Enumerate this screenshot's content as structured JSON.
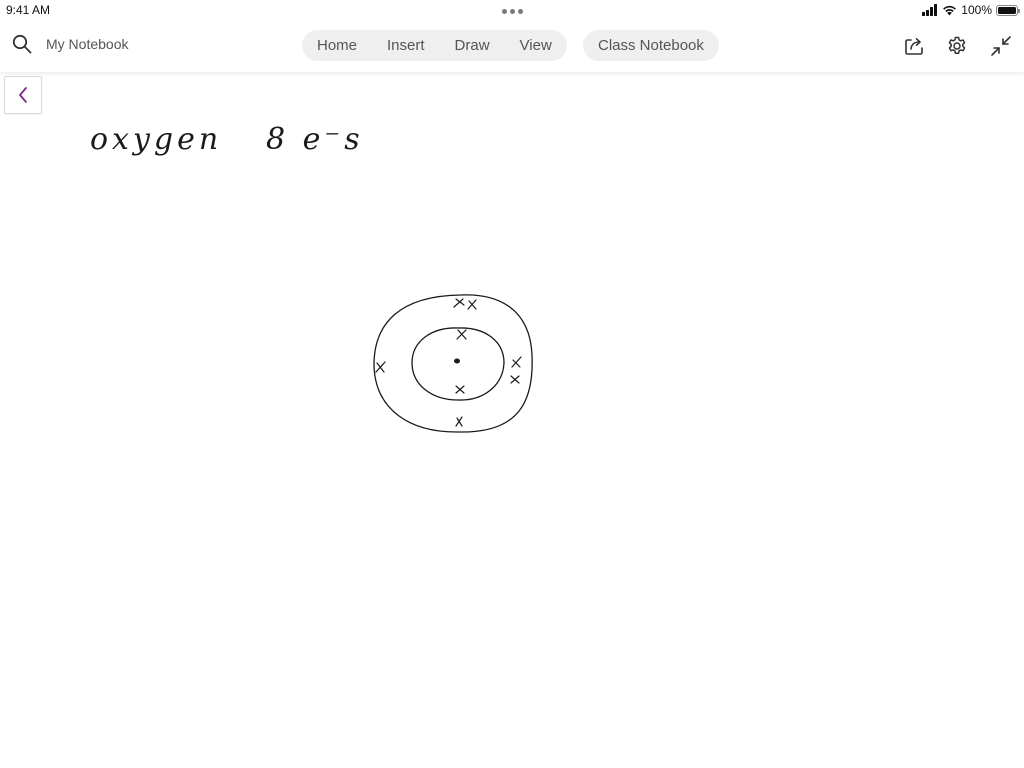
{
  "status_bar": {
    "time": "9:41 AM",
    "battery": "100%",
    "battery_level": 1.0
  },
  "toolbar": {
    "notebook_name": "My Notebook",
    "tabs": [
      {
        "label": "Home"
      },
      {
        "label": "Insert"
      },
      {
        "label": "Draw"
      },
      {
        "label": "View"
      }
    ],
    "class_notebook": "Class Notebook",
    "icons": [
      "search-icon",
      "share-icon",
      "gear-icon",
      "collapse-icon"
    ]
  },
  "canvas": {
    "back_icon": "chevron-left-icon",
    "handwriting": {
      "title": "oxygen",
      "electrons": "8 e⁻s"
    },
    "diagram": {
      "nucleus": "•",
      "electron_mark": "x",
      "inner_shell_electrons": 2,
      "outer_shell_electrons": 6
    },
    "accent_color": "#7a2a8c"
  }
}
